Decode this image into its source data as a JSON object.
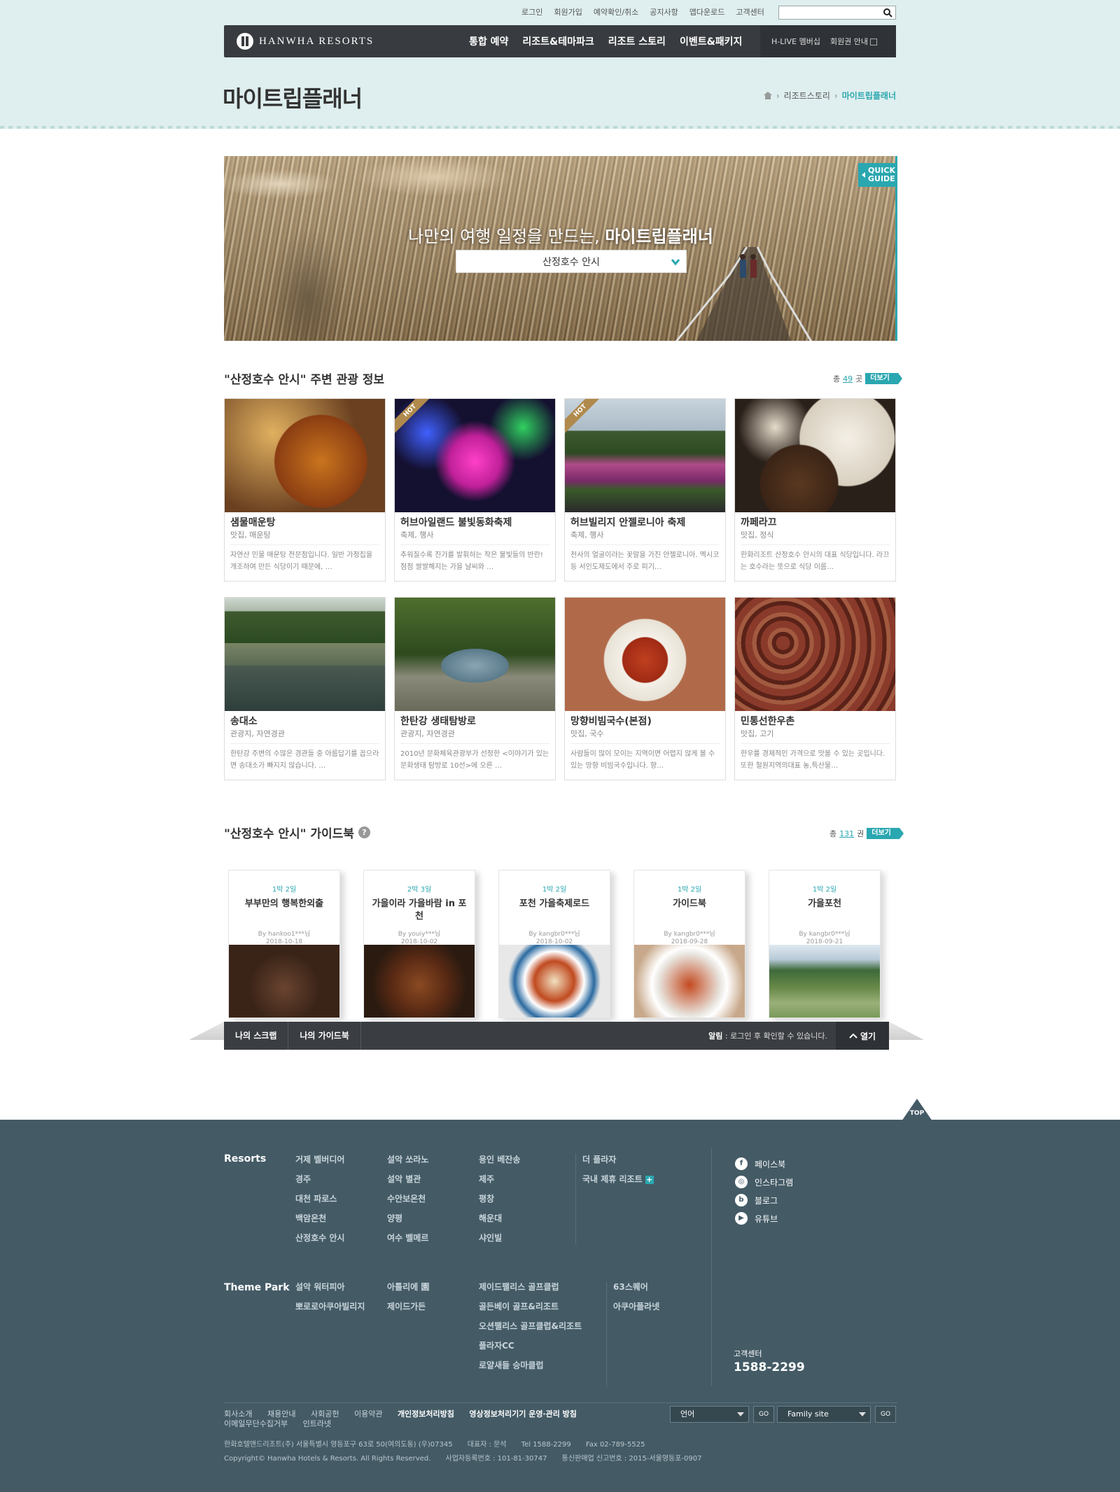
{
  "util_links": [
    "로그인",
    "회원가입",
    "예약확인/취소",
    "공지사항",
    "앱다운로드",
    "고객센터"
  ],
  "brand": "HANWHA RESORTS",
  "gnb": [
    "통합 예약",
    "리조트&테마파크",
    "리조트 스토리",
    "이벤트&패키지"
  ],
  "gnb_right": [
    "H-LIVE 멤버십",
    "회원권 안내"
  ],
  "page_title": "마이트립플래너",
  "breadcrumb": [
    "리조트스토리",
    "마이트립플래너"
  ],
  "hero": {
    "title_normal": "나만의 여행 일정을 만드는, ",
    "title_bold": "마이트립플래너",
    "selected": "산정호수 안시",
    "quick_guide": [
      "QUICK",
      "GUIDE"
    ]
  },
  "attractions": {
    "title": "\"산정호수 안시\" 주변 관광 정보",
    "count_prefix": "총",
    "count": "49",
    "count_suffix": "곳",
    "more": "더보기",
    "hot_label": "HOT",
    "items": [
      {
        "name": "샘물매운탕",
        "cat": "맛집, 매운탕",
        "desc": "자연산 민물 매운탕 전문점입니다. 일반 가정집을 개조하여 만든 식당이기 때문에, …",
        "hot": false
      },
      {
        "name": "허브아일랜드 불빛동화축제",
        "cat": "축제, 행사",
        "desc": "추워질수록 진가를 발휘하는 작은 불빛들의 반란! 점점 쌀쌀해지는 가을 날씨와 …",
        "hot": true
      },
      {
        "name": "허브빌리지 안젤로니아 축제",
        "cat": "축제, 행사",
        "desc": "천사의 얼굴이라는 꽃말을 가진 안젤로니아. 멕시코 등 서인도제도에서 주로 피기…",
        "hot": true
      },
      {
        "name": "까페라끄",
        "cat": "맛집, 정식",
        "desc": "한화리조트 산정호수 안시의 대표 식당입니다. 라끄는 호수라는 뜻으로 식당 이름…",
        "hot": false
      },
      {
        "name": "송대소",
        "cat": "관광지, 자연경관",
        "desc": "한탄강 주변의 수많은 경관들 중 아름답기를 꼽으라면 송대소가 빠지지 않습니다. …",
        "hot": false
      },
      {
        "name": "한탄강 생태탐방로",
        "cat": "관광지, 자연경관",
        "desc": "2010년 문화체육관광부가 선정한 <이야기가 있는 문화생태 탐방로 10선>에 오른 …",
        "hot": false
      },
      {
        "name": "망향비빔국수(본점)",
        "cat": "맛집, 국수",
        "desc": "사람들이 많이 모이는 지역이면 어렵지 않게 볼 수 있는 망향 비빔국수입니다. 향…",
        "hot": false
      },
      {
        "name": "민통선한우촌",
        "cat": "맛집, 고기",
        "desc": "한우를 경제적인 가격으로 맛볼 수 있는 곳입니다. 또한 철원지역의대표 농,특산물…",
        "hot": false
      }
    ]
  },
  "guidebook": {
    "title": "\"산정호수 안시\" 가이드북",
    "count_prefix": "총",
    "count": "131",
    "count_suffix": "권",
    "more": "더보기",
    "help": "?",
    "books": [
      {
        "nights": "1박 2일",
        "title": "부부만의 행복한외출",
        "author": "By hankoo1***님",
        "date": "2018-10-18"
      },
      {
        "nights": "2박 3일",
        "title": "가을이라 가을바람 in 포천",
        "author": "By youiy***님",
        "date": "2018-10-02"
      },
      {
        "nights": "1박 2일",
        "title": "포천 가을축제로드",
        "author": "By kangbr0***님",
        "date": "2018-10-02"
      },
      {
        "nights": "1박 2일",
        "title": "가이드북",
        "author": "By kangbr0***님",
        "date": "2018-09-28"
      },
      {
        "nights": "1박 2일",
        "title": "가을포천",
        "author": "By kangbr0***님",
        "date": "2018-09-21"
      }
    ]
  },
  "shelf": {
    "tabs": [
      "나의 스크랩",
      "나의 가이드북"
    ],
    "notice_bold": "알림",
    "notice": " : 로그인 후 확인할 수 있습니다.",
    "open": "열기"
  },
  "footer": {
    "top": "TOP",
    "resorts_label": "Resorts",
    "resorts_cols": [
      [
        "거제 벨버디어",
        "경주",
        "대천 파로스",
        "백암온천",
        "산정호수 안시"
      ],
      [
        "설악 쏘라노",
        "설악 별관",
        "수안보온천",
        "양평",
        "여수 벨메르"
      ],
      [
        "용인 베잔송",
        "제주",
        "평창",
        "해운대",
        "샤인빌"
      ],
      [
        "더 플라자",
        "국내 제휴 리조트"
      ]
    ],
    "theme_label": "Theme Park",
    "theme_cols": [
      [
        "설악 워터피아",
        "뽀로로아쿠아빌리지"
      ],
      [
        "아틀리에 園",
        "제이드가든"
      ],
      [
        "제이드팰리스 골프클럽",
        "골든베이 골프&리조트",
        "오션팰리스 골프클럽&리조트",
        "플라자CC",
        "로얄새들 승마클럽"
      ],
      [
        "63스퀘어",
        "아쿠아플라넷"
      ]
    ],
    "sns": [
      {
        "icon": "f",
        "label": "페이스북"
      },
      {
        "icon": "◎",
        "label": "인스타그램"
      },
      {
        "icon": "b",
        "label": "블로그"
      },
      {
        "icon": "▶",
        "label": "유튜브"
      }
    ],
    "cs_label": "고객센터",
    "cs_number": "1588-2299",
    "links": [
      {
        "t": "회사소개",
        "b": false
      },
      {
        "t": "채용안내",
        "b": false
      },
      {
        "t": "사회공헌",
        "b": false
      },
      {
        "t": "이용약관",
        "b": false
      },
      {
        "t": "개인정보처리방침",
        "b": true
      },
      {
        "t": "영상정보처리기기 운영·관리 방침",
        "b": true
      },
      {
        "t": "이메일무단수집거부",
        "b": false
      },
      {
        "t": "인트라넷",
        "b": false
      }
    ],
    "info1": [
      "한화호텔앤드리조트(주) 서울특별시 영등포구 63로 50(여의도동) (우)07345",
      "대표자 : 문석",
      "Tel 1588-2299",
      "Fax 02-789-5525"
    ],
    "info2": [
      "Copyright© Hanwha Hotels & Resorts. All Rights Reserved.",
      "사업자등록번호 : 101-81-30747",
      "통신판매업 신고번호 : 2015-서울영등포-0907"
    ],
    "lang": "언어",
    "family": "Family site",
    "go": "GO"
  }
}
